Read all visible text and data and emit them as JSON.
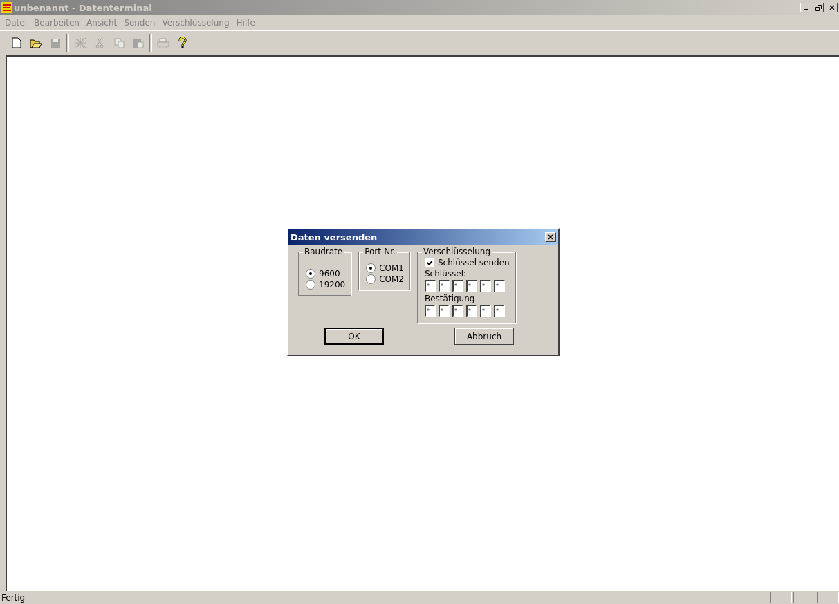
{
  "window": {
    "title": "unbenannt - Datenterminal",
    "active": false
  },
  "menu": [
    "Datei",
    "Bearbeiten",
    "Ansicht",
    "Senden",
    "Verschlüsselung",
    "Hilfe"
  ],
  "toolbar": [
    {
      "kind": "new",
      "disabled": false
    },
    {
      "kind": "open",
      "disabled": false
    },
    {
      "kind": "save",
      "disabled": true
    },
    {
      "kind": "sep"
    },
    {
      "kind": "pattern",
      "disabled": true
    },
    {
      "kind": "cut",
      "disabled": true
    },
    {
      "kind": "copy",
      "disabled": true
    },
    {
      "kind": "paste",
      "disabled": true
    },
    {
      "kind": "sep"
    },
    {
      "kind": "print",
      "disabled": true
    },
    {
      "kind": "help",
      "disabled": false
    }
  ],
  "dialog": {
    "title": "Daten versenden",
    "groups": [
      {
        "title": "Baudrate",
        "options": [
          {
            "label": "9600",
            "selected": true
          },
          {
            "label": "19200",
            "selected": false
          }
        ]
      },
      {
        "title": "Port-Nr.",
        "options": [
          {
            "label": "COM1",
            "selected": true
          },
          {
            "label": "COM2",
            "selected": false
          }
        ]
      }
    ],
    "encryption": {
      "title": "Verschlüsselung",
      "checkbox": {
        "label": "Schlüssel senden",
        "checked": true
      },
      "key_label": "Schlüssel:",
      "key": [
        "*",
        "*",
        "*",
        "*",
        "*",
        "*"
      ],
      "confirm_label": "Bestätigung",
      "confirm": [
        "*",
        "*",
        "*",
        "*",
        "*",
        "*"
      ]
    },
    "buttons": [
      {
        "label": "OK",
        "default": true
      },
      {
        "label": "Abbruch",
        "default": false
      }
    ]
  },
  "status_bar": {
    "text": "Fertig"
  }
}
